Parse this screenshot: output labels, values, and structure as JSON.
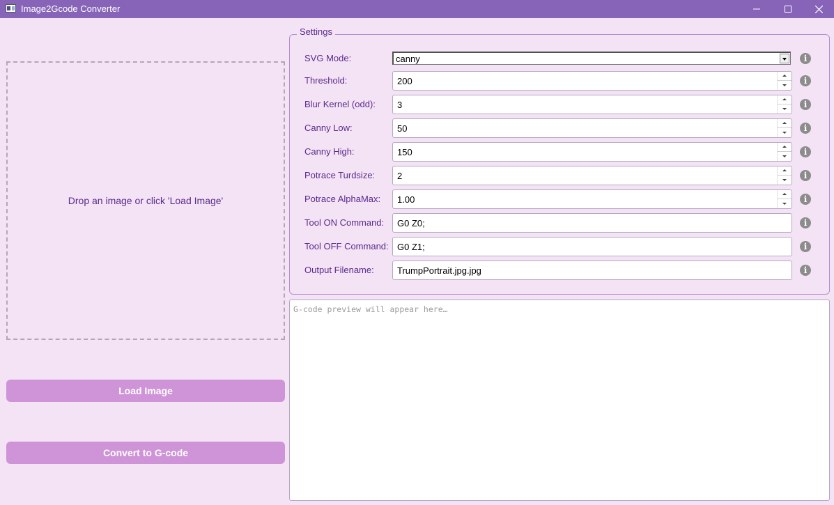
{
  "window": {
    "title": "Image2Gcode Converter"
  },
  "dropzone": {
    "text": "Drop an image or click 'Load Image'"
  },
  "buttons": {
    "load": "Load Image",
    "convert": "Convert to G-code"
  },
  "settings": {
    "legend": "Settings",
    "svg_mode": {
      "label": "SVG Mode:",
      "value": "canny"
    },
    "threshold": {
      "label": "Threshold:",
      "value": "200"
    },
    "blur_kernel": {
      "label": "Blur Kernel (odd):",
      "value": "3"
    },
    "canny_low": {
      "label": "Canny Low:",
      "value": "50"
    },
    "canny_high": {
      "label": "Canny High:",
      "value": "150"
    },
    "turdsize": {
      "label": "Potrace Turdsize:",
      "value": "2"
    },
    "alphamax": {
      "label": "Potrace AlphaMax:",
      "value": "1.00"
    },
    "tool_on": {
      "label": "Tool ON Command:",
      "value": "G0 Z0;"
    },
    "tool_off": {
      "label": "Tool OFF Command:",
      "value": "G0 Z1;"
    },
    "output_filename": {
      "label": "Output Filename:",
      "value": "TrumpPortrait.jpg.jpg"
    },
    "info_glyph": "i"
  },
  "preview": {
    "placeholder": "G-code preview will appear here…"
  },
  "colors": {
    "titlebar": "#8764b8",
    "background": "#f3e3f5",
    "accent_text": "#5b2a8c",
    "button": "#cf94d8"
  }
}
